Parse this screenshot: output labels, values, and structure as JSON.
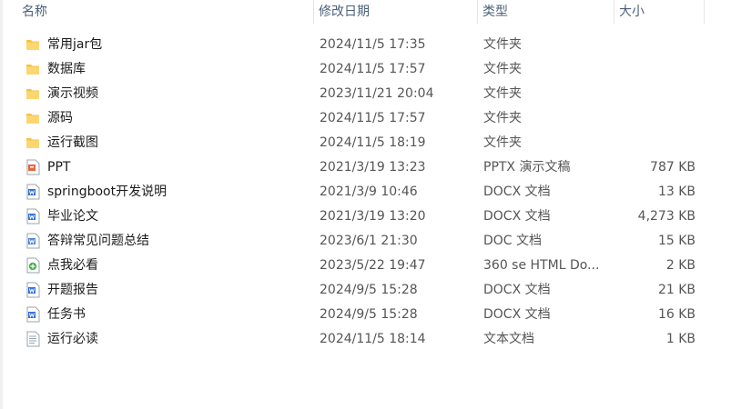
{
  "columns": {
    "name": "名称",
    "date": "修改日期",
    "type": "类型",
    "size": "大小"
  },
  "partial_glyph": "^",
  "files": [
    {
      "name": "常用jar包",
      "date": "2024/11/5 17:35",
      "type": "文件夹",
      "size": "",
      "icon": "folder-icon"
    },
    {
      "name": "数据库",
      "date": "2024/11/5 17:57",
      "type": "文件夹",
      "size": "",
      "icon": "folder-icon"
    },
    {
      "name": "演示视频",
      "date": "2023/11/21 20:04",
      "type": "文件夹",
      "size": "",
      "icon": "folder-icon"
    },
    {
      "name": "源码",
      "date": "2024/11/5 17:57",
      "type": "文件夹",
      "size": "",
      "icon": "folder-icon"
    },
    {
      "name": "运行截图",
      "date": "2024/11/5 18:19",
      "type": "文件夹",
      "size": "",
      "icon": "folder-icon"
    },
    {
      "name": "PPT",
      "date": "2021/3/19 13:23",
      "type": "PPTX 演示文稿",
      "size": "787 KB",
      "icon": "pptx-icon"
    },
    {
      "name": "springboot开发说明",
      "date": "2021/3/9 10:46",
      "type": "DOCX 文档",
      "size": "13 KB",
      "icon": "docx-icon"
    },
    {
      "name": "毕业论文",
      "date": "2021/3/19 13:20",
      "type": "DOCX 文档",
      "size": "4,273 KB",
      "icon": "docx-icon"
    },
    {
      "name": "答辩常见问题总结",
      "date": "2023/6/1 21:30",
      "type": "DOC 文档",
      "size": "15 KB",
      "icon": "doc-icon"
    },
    {
      "name": "点我必看",
      "date": "2023/5/22 19:47",
      "type": "360 se HTML Do...",
      "size": "2 KB",
      "icon": "html-icon"
    },
    {
      "name": "开题报告",
      "date": "2024/9/5 15:28",
      "type": "DOCX 文档",
      "size": "21 KB",
      "icon": "docx-icon"
    },
    {
      "name": "任务书",
      "date": "2024/9/5 15:28",
      "type": "DOCX 文档",
      "size": "16 KB",
      "icon": "docx-icon"
    },
    {
      "name": "运行必读",
      "date": "2024/11/5 18:14",
      "type": "文本文档",
      "size": "1 KB",
      "icon": "txt-icon"
    }
  ],
  "colors": {
    "folder": "#f6c342",
    "pptx": "#e8663d",
    "docx": "#2f6fd6",
    "html": "#4caf50",
    "header_text": "#4c607a"
  }
}
